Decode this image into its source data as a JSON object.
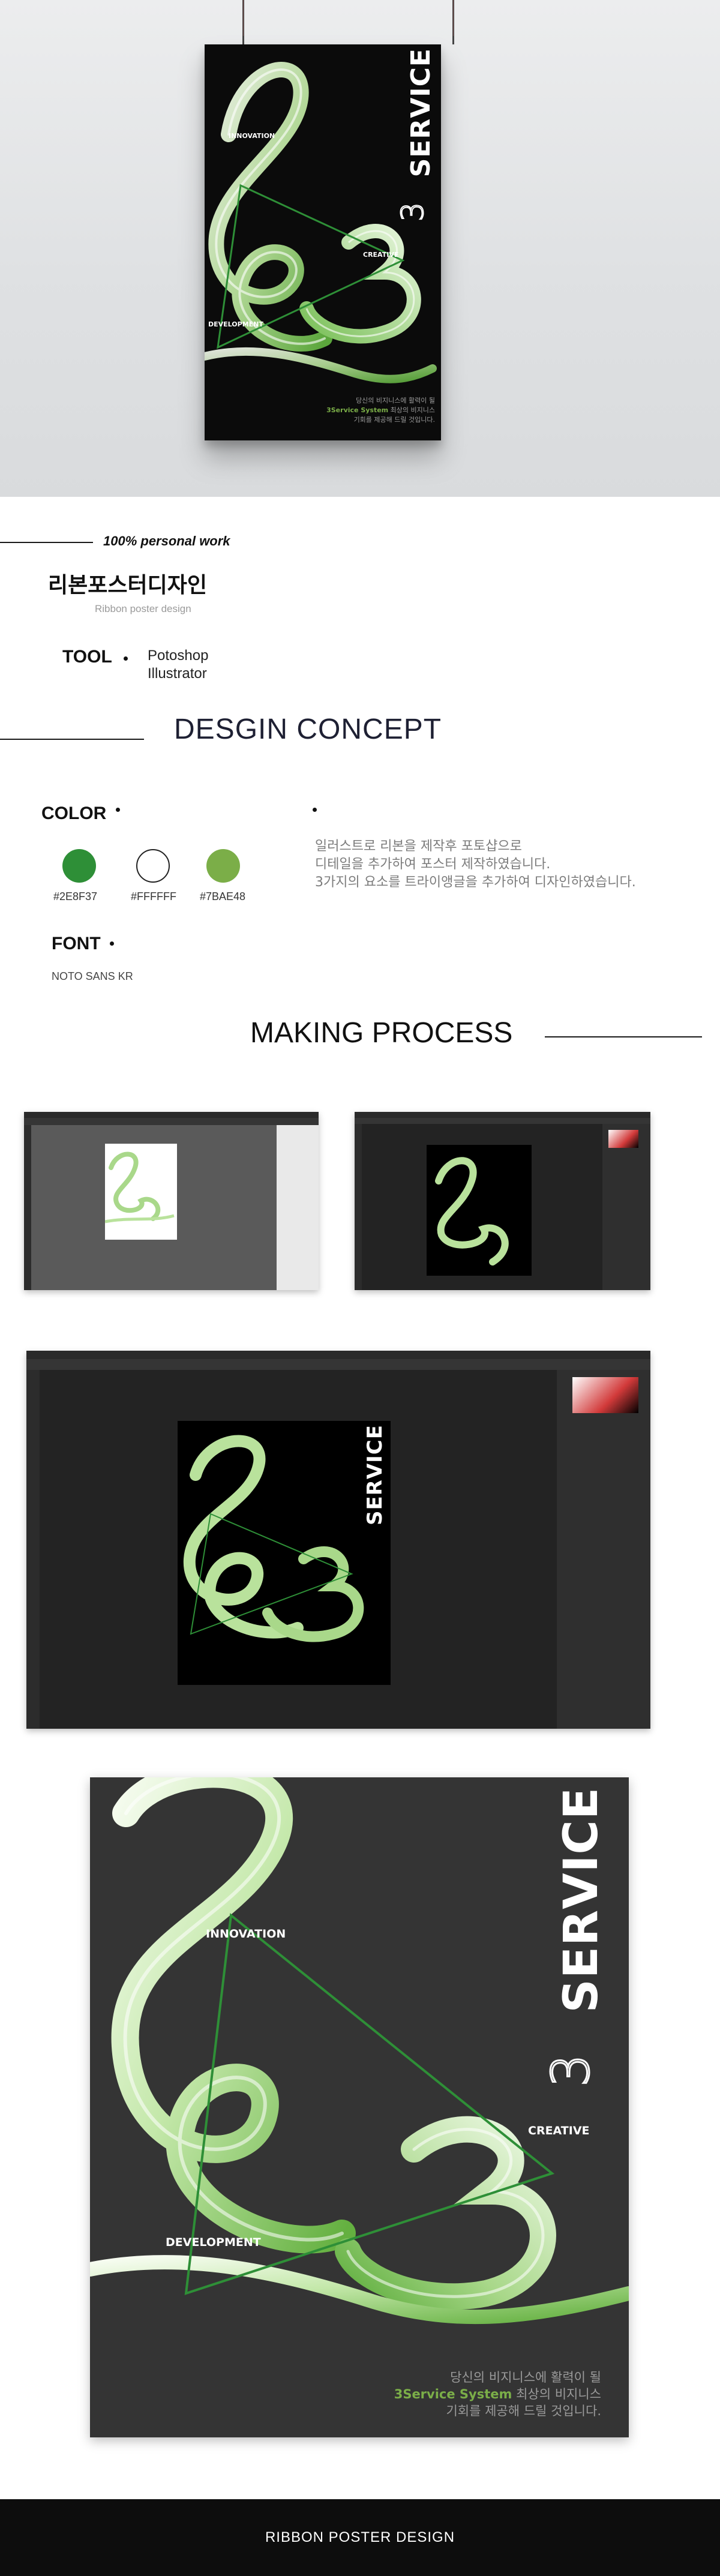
{
  "colors": {
    "green_dark": "#2E8F37",
    "white": "#FFFFFF",
    "green_light": "#7BAE48",
    "ribbon_light": "#dff3cf",
    "ribbon_mid": "#a9d88a",
    "poster_bg": "#0b0b0b",
    "final_bg": "#343434"
  },
  "poster": {
    "title": "SERVICE",
    "number": "3",
    "labels": {
      "innovation": "INNOVATION",
      "creative": "CREATIVE",
      "development": "DEVELOPMENT"
    },
    "caption_line1": "당신의 비지니스에 활력이 될",
    "caption_brand": "3Service System",
    "caption_line2_rest": " 최상의 비지니스",
    "caption_line3": "기회를 제공해 드릴 것입니다."
  },
  "intro": {
    "tagline": "100%  personal work",
    "title_ko": "리본포스터디자인",
    "subtitle_en": "Ribbon poster design",
    "tool_label": "TOOL",
    "tools": [
      "Potoshop",
      "Illustrator"
    ]
  },
  "concept": {
    "heading": "DESGIN CONCEPT",
    "color_label": "COLOR",
    "swatches": [
      {
        "hex": "#2E8F37",
        "label": "#2E8F37"
      },
      {
        "hex": "#FFFFFF",
        "label": "#FFFFFF"
      },
      {
        "hex": "#7BAE48",
        "label": "#7BAE48"
      }
    ],
    "description": [
      "일러스트로 리본을 제작후 포토샵으로",
      "디테일을 추가하여 포스터 제작하였습니다.",
      "3가지의 요소를 트라이앵글을 추가하여 디자인하였습니다."
    ],
    "font_label": "FONT",
    "font_name": "NOTO SANS KR"
  },
  "process": {
    "heading": "MAKING PROCESS"
  },
  "footer": {
    "title": "RIBBON POSTER DESIGN"
  }
}
